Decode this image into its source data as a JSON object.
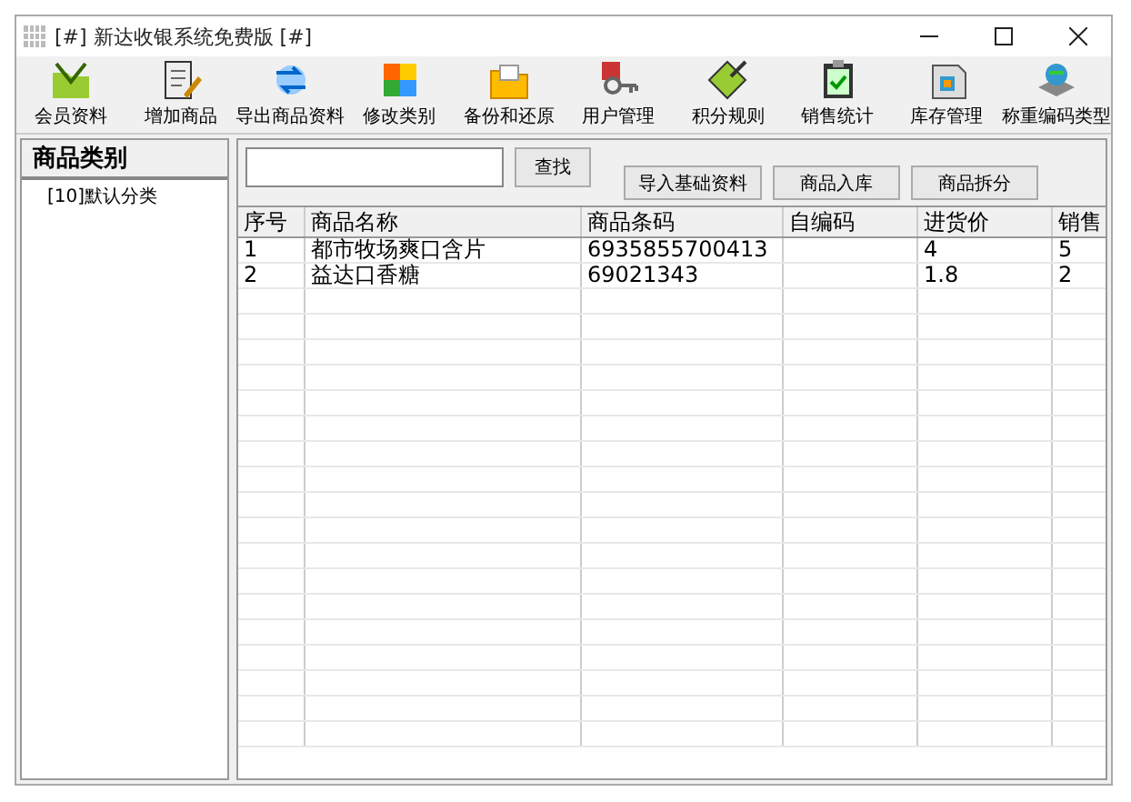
{
  "window": {
    "title": "[#] 新达收银系统免费版 [#]"
  },
  "toolbar": [
    {
      "label": "会员资料",
      "kind": "member"
    },
    {
      "label": "增加商品",
      "kind": "add"
    },
    {
      "label": "导出商品资料",
      "kind": "export"
    },
    {
      "label": "修改类别",
      "kind": "category"
    },
    {
      "label": "备份和还原",
      "kind": "backup"
    },
    {
      "label": "用户管理",
      "kind": "user"
    },
    {
      "label": "积分规则",
      "kind": "points"
    },
    {
      "label": "销售统计",
      "kind": "sales"
    },
    {
      "label": "库存管理",
      "kind": "stock"
    },
    {
      "label": "称重编码类型",
      "kind": "weigh"
    }
  ],
  "sidebar": {
    "title": "商品类别",
    "items": [
      {
        "label": "[10]默认分类",
        "selected": false
      }
    ]
  },
  "search": {
    "button": "查找"
  },
  "actions": [
    "导入基础资料",
    "商品入库",
    "商品拆分"
  ],
  "table": {
    "columns": [
      "序号",
      "商品名称",
      "商品条码",
      "自编码",
      "进货价",
      "销售"
    ],
    "rows": [
      [
        "1",
        "都市牧场爽口含片",
        "6935855700413",
        "",
        "4",
        "5"
      ],
      [
        "2",
        "益达口香糖",
        "69021343",
        "",
        "1.8",
        "2"
      ]
    ]
  }
}
